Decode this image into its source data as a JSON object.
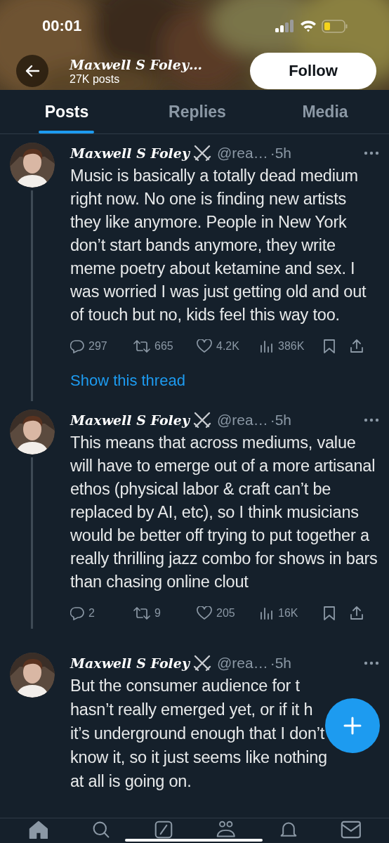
{
  "status_bar": {
    "time": "00:01"
  },
  "header": {
    "name": "Maxwell S Foley…",
    "posts": "27K posts",
    "follow": "Follow"
  },
  "tabs": [
    {
      "label": "Posts",
      "selected": true
    },
    {
      "label": "Replies",
      "selected": false
    },
    {
      "label": "Media",
      "selected": false
    }
  ],
  "posts": [
    {
      "name": "Maxwell S Foley",
      "handle": "@rea…",
      "time": "·5h",
      "text": "Music is basically a totally dead medium right now. No one is finding new artists they like anymore. People in New York don’t start bands anymore, they write meme poetry about ketamine and sex. I was worried I was just getting old and out of touch but no, kids feel this way too.",
      "stats": [
        {
          "kind": "reply",
          "count": "297"
        },
        {
          "kind": "repost",
          "count": "665"
        },
        {
          "kind": "like",
          "count": "4.2K"
        },
        {
          "kind": "views",
          "count": "386K"
        },
        {
          "kind": "bookmark"
        },
        {
          "kind": "share"
        }
      ],
      "show_thread": "Show this thread"
    },
    {
      "name": "Maxwell S Foley",
      "handle": "@rea…",
      "time": "·5h",
      "text": "This means that across mediums, value will have to emerge out of a more artisanal ethos (physical labor & craft can’t be replaced by AI, etc), so I think musicians would be better off trying to put together a really thrilling jazz combo for shows in bars than chasing online clout",
      "stats": [
        {
          "kind": "reply",
          "count": "2"
        },
        {
          "kind": "repost",
          "count": "9"
        },
        {
          "kind": "like",
          "count": "205"
        },
        {
          "kind": "views",
          "count": "16K"
        },
        {
          "kind": "bookmark"
        },
        {
          "kind": "share"
        }
      ]
    },
    {
      "name": "Maxwell S Foley",
      "handle": "@rea…",
      "time": "·5h",
      "lines": [
        "But the consumer audience for t",
        "hasn’t really emerged yet, or if it h",
        "it’s underground enough that I don’t",
        "know it, so it just seems like nothing",
        "at all is going on."
      ]
    }
  ],
  "nav": [
    {
      "kind": "home",
      "selected": true
    },
    {
      "kind": "search",
      "selected": false
    },
    {
      "kind": "compose",
      "selected": false
    },
    {
      "kind": "communities",
      "selected": false
    },
    {
      "kind": "notifications",
      "selected": false
    },
    {
      "kind": "messages",
      "selected": false
    }
  ]
}
